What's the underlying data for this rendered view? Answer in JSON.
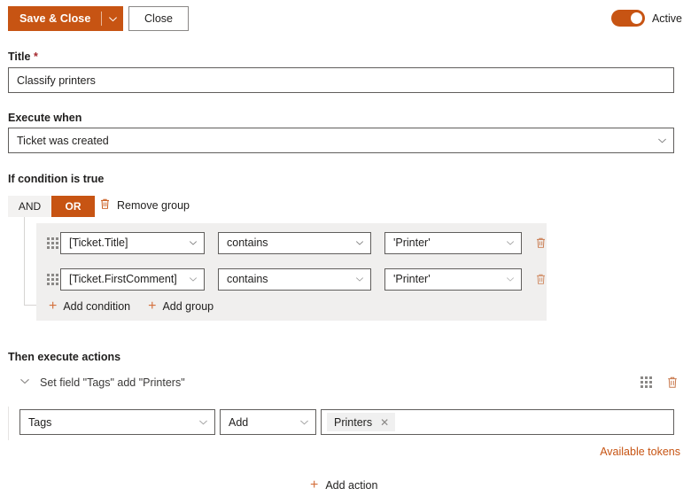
{
  "toolbar": {
    "save_label": "Save & Close",
    "save_caret_icon": "chevron-down-icon",
    "close_label": "Close",
    "toggle_state_label": "Active",
    "accent_color": "#c75413"
  },
  "title_field": {
    "label": "Title",
    "required_marker": "*",
    "value": "Classify printers"
  },
  "execute_when": {
    "label": "Execute when",
    "value": "Ticket was created"
  },
  "condition_section": {
    "heading": "If condition is true",
    "operators": [
      {
        "label": "AND",
        "active": false
      },
      {
        "label": "OR",
        "active": true
      }
    ],
    "remove_group_label": "Remove group",
    "remove_group_icon": "trash-icon",
    "rows": [
      {
        "drag_icon": "drag-handle-icon",
        "field": "[Ticket.Title]",
        "operator": "contains",
        "value": "'Printer'",
        "delete_icon": "trash-icon"
      },
      {
        "drag_icon": "drag-handle-icon",
        "field": "[Ticket.FirstComment]",
        "operator": "contains",
        "value": "'Printer'",
        "delete_icon": "trash-icon"
      }
    ],
    "add_condition_label": "Add condition",
    "add_group_label": "Add group"
  },
  "action_section": {
    "heading": "Then execute actions",
    "collapse_icon": "chevron-down-icon",
    "summary": "Set field \"Tags\" add \"Printers\"",
    "drag_icon": "drag-handle-icon",
    "delete_icon": "trash-icon",
    "field_value": "Tags",
    "operation_value": "Add",
    "tags": [
      {
        "label": "Printers",
        "remove_icon": "close-icon"
      }
    ],
    "available_tokens_label": "Available tokens",
    "add_action_label": "Add action"
  }
}
